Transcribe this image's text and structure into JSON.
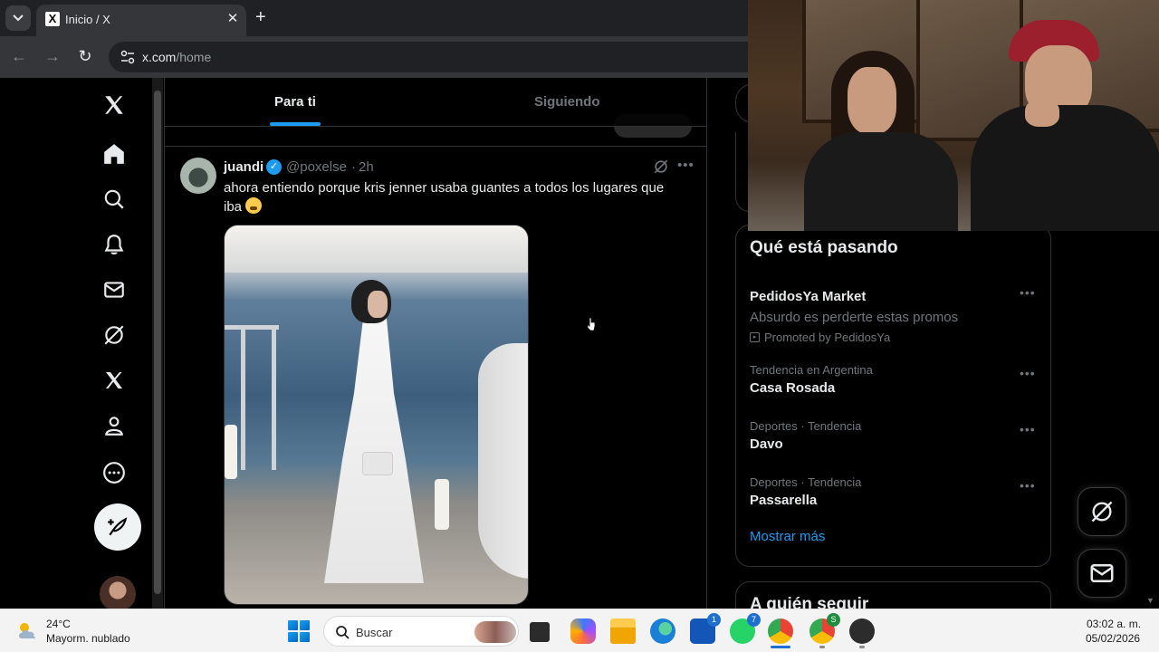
{
  "browser": {
    "tab_title": "Inicio / X",
    "favicon": "X",
    "url_domain": "x.com",
    "url_path": "/home"
  },
  "feed": {
    "tabs": [
      {
        "label": "Para ti",
        "active": true
      },
      {
        "label": "Siguiendo",
        "active": false
      }
    ]
  },
  "tweet": {
    "name": "juandi",
    "handle": "@poxelse",
    "separator": "·",
    "time": "2h",
    "text": "ahora entiendo porque kris jenner usaba guantes a todos los lugares que iba"
  },
  "trends": {
    "title": "Qué está pasando",
    "items": [
      {
        "meta": "",
        "name": "PedidosYa Market",
        "sub": "Absurdo es perderte estas promos",
        "promo": "Promoted by PedidosYa"
      },
      {
        "meta": "Tendencia en Argentina",
        "name": "Casa Rosada"
      },
      {
        "meta": "Deportes · Tendencia",
        "name": "Davo"
      },
      {
        "meta": "Deportes · Tendencia",
        "name": "Passarella"
      }
    ],
    "show_more": "Mostrar más"
  },
  "who_to_follow": {
    "title": "A quién seguir"
  },
  "taskbar": {
    "weather_temp": "24°C",
    "weather_desc": "Mayorm. nublado",
    "search_placeholder": "Buscar",
    "time": "03:02 a. m.",
    "date": "05/02/2026",
    "badges": {
      "store": "1",
      "whatsapp": "7",
      "chrome_profile": "S"
    }
  },
  "colors": {
    "accent": "#1d9bf0",
    "bg": "#000000",
    "muted": "#71767b"
  }
}
